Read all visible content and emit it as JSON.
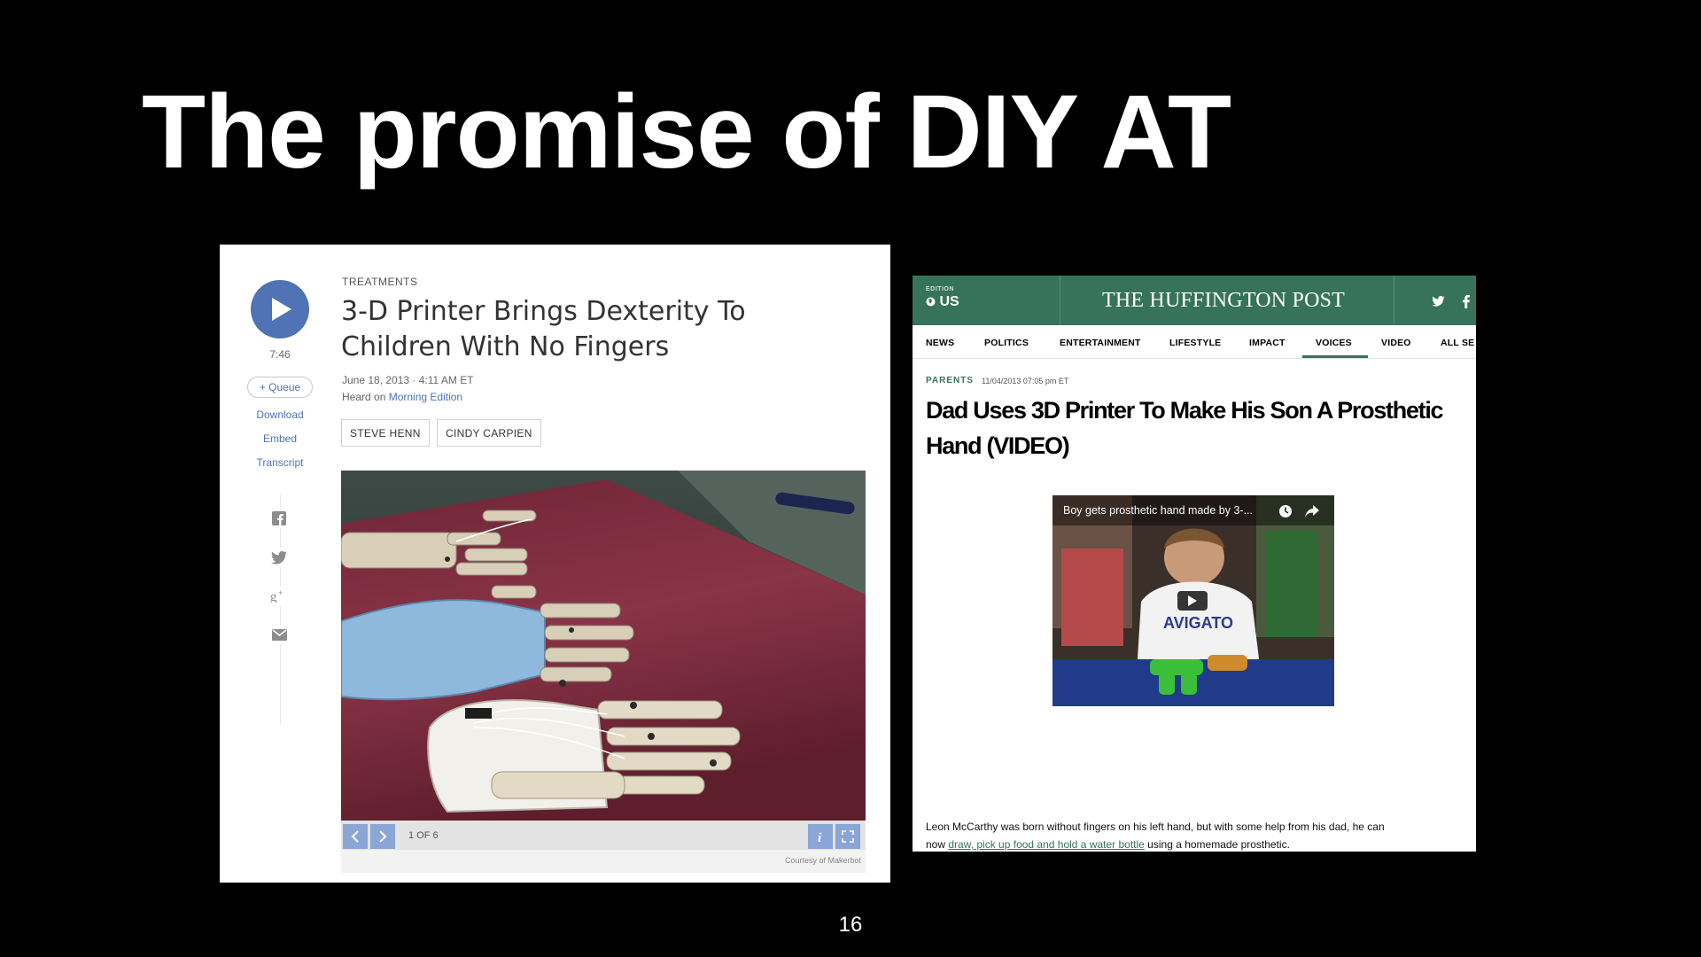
{
  "slide": {
    "title": "The promise of DIY AT",
    "page_number": "16"
  },
  "npr": {
    "duration": "7:46",
    "queue_label": "+ Queue",
    "side_links": [
      "Download",
      "Embed",
      "Transcript"
    ],
    "share_icons": [
      "facebook-icon",
      "twitter-icon",
      "google-plus-icon",
      "email-icon"
    ],
    "section": "TREATMENTS",
    "headline": "3-D Printer Brings Dexterity To Children With No Fingers",
    "dateline": "June 18, 2013 · 4:11 AM ET",
    "heard_on_prefix": "Heard on ",
    "program": "Morning Edition",
    "bylines": [
      "STEVE HENN",
      "CINDY CARPIEN"
    ],
    "photo_count": "1 OF 6",
    "photo_credit": "Courtesy of Makerbot",
    "accent_color": "#4f73b4"
  },
  "huff": {
    "edition_label": "EDITION",
    "edition_value": "US",
    "brand": "THE HUFFINGTON POST",
    "social": [
      "twitter-icon",
      "facebook-icon"
    ],
    "nav": [
      "NEWS",
      "POLITICS",
      "ENTERTAINMENT",
      "LIFESTYLE",
      "IMPACT",
      "VOICES",
      "VIDEO",
      "ALL SE"
    ],
    "active_nav": "VOICES",
    "kicker": "PARENTS",
    "kicker_date": "11/04/2013 07:05 pm ET",
    "headline": "Dad Uses 3D Printer To Make His Son A Prosthetic Hand (VIDEO)",
    "video_title": "Boy gets prosthetic hand made by 3-...",
    "body_line1": "Leon McCarthy was born without fingers on his left hand, but with some help from his dad, he can",
    "body_line2_prefix": "now ",
    "body_link": "draw, pick up food and hold a water bottle",
    "body_line2_suffix": " using a homemade prosthetic.",
    "brand_color": "#36735a"
  }
}
